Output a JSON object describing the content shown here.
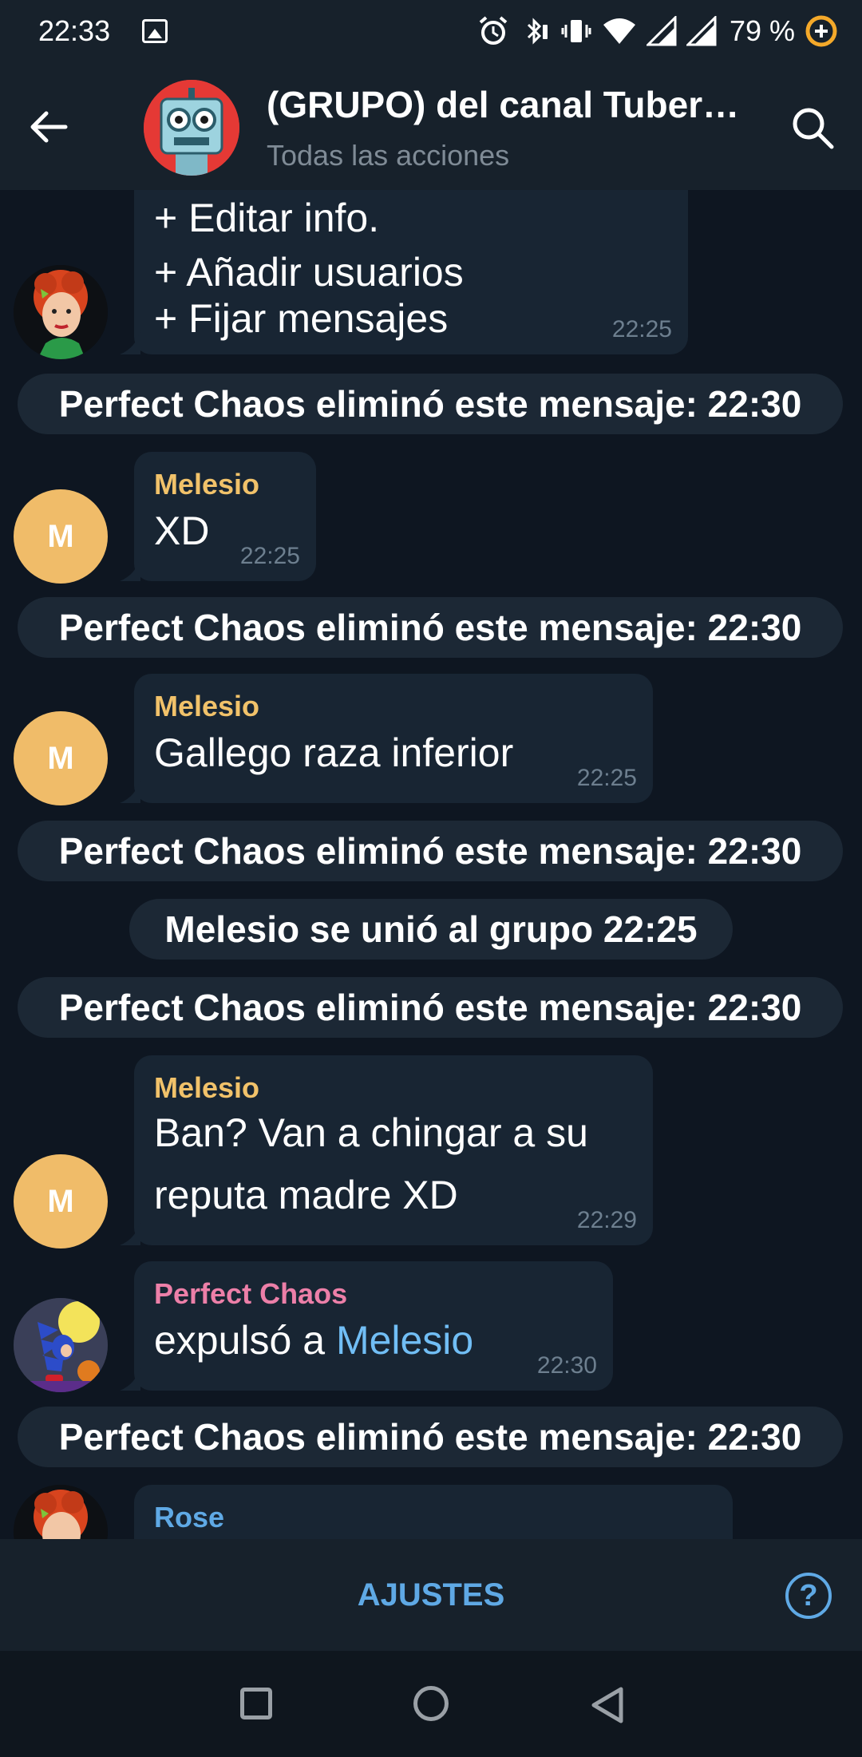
{
  "status_bar": {
    "time": "22:33",
    "battery": "79 %"
  },
  "header": {
    "title": "(GRUPO) del canal Tuber…",
    "subtitle": "Todas las acciones"
  },
  "messages": {
    "m0": {
      "line1": "+ Editar info.",
      "line2": "+ Añadir usuarios",
      "line3": "+ Fijar mensajes",
      "time": "22:25"
    },
    "s1": "Perfect Chaos eliminó este mensaje:  22:30",
    "m1": {
      "sender": "Melesio",
      "text": "XD",
      "time": "22:25"
    },
    "s2": "Perfect Chaos eliminó este mensaje:  22:30",
    "m2": {
      "sender": "Melesio",
      "text": "Gallego raza inferior",
      "time": "22:25"
    },
    "s3": "Perfect Chaos eliminó este mensaje:  22:30",
    "s4": "Melesio se unió al grupo  22:25",
    "s5": "Perfect Chaos eliminó este mensaje:  22:30",
    "m3": {
      "sender": "Melesio",
      "line1": "Ban? Van a chingar a su",
      "line2": "reputa madre XD",
      "time": "22:29"
    },
    "m4": {
      "sender": "Perfect Chaos",
      "text_prefix": "expulsó a ",
      "link": "Melesio",
      "time": "22:30"
    },
    "s6": "Perfect Chaos eliminó este mensaje:  22:30",
    "m5": {
      "sender": "Rose"
    },
    "avatar_letter": "M"
  },
  "bottom_bar": {
    "settings_label": "AJUSTES",
    "help_label": "?"
  },
  "colors": {
    "sender_melesio": "#f1c26a",
    "sender_perfect_chaos": "#ec7fa8",
    "sender_rose": "#5fa9e5",
    "link": "#71bef5",
    "accent": "#5fa9e5"
  }
}
